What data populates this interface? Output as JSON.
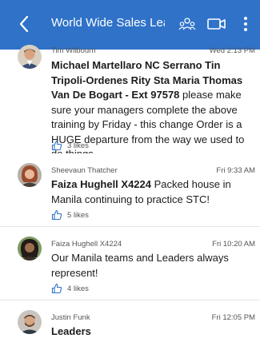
{
  "header": {
    "title": "World Wide Sales Lead..."
  },
  "posts": [
    {
      "author": "Tim Wilbourn",
      "time": "Wed 2:13 PM",
      "bold": "Michael Martellaro NC Serrano Tin Tripoli-Ordenes  Rity Sta Maria Thomas Van De Bogart - Ext 97578",
      "text": "  please make sure your managers complete the above training by Friday - this change Order is a HUGE departure from the way we used to do things.",
      "likes": "3 likes"
    },
    {
      "author": "Sheevaun Thatcher",
      "time": "Fri 9:33 AM",
      "bold": "Faiza Hughell X4224",
      "text": "  Packed house in Manila continuing to practice STC!",
      "likes": "5 likes"
    },
    {
      "author": "Faiza Hughell X4224",
      "time": "Fri 10:20 AM",
      "bold": "",
      "text": "Our Manila teams and Leaders always represent!",
      "likes": "4 likes"
    },
    {
      "author": "Justin Funk",
      "time": "Fri 12:05 PM",
      "bold": "Leaders",
      "text": "",
      "likes": ""
    }
  ]
}
